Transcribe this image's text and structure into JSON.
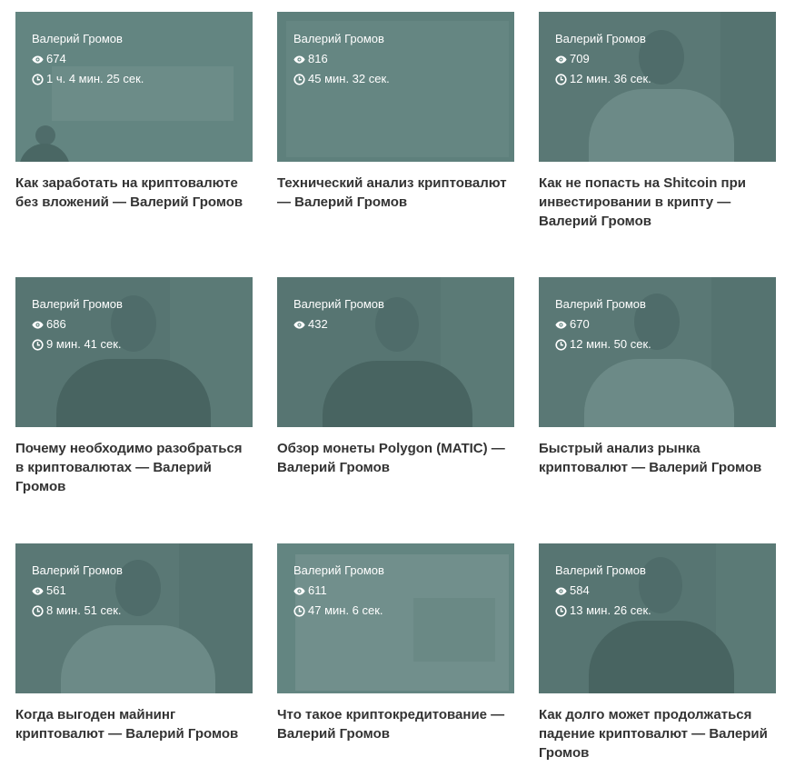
{
  "cards": [
    {
      "author": "Валерий Громов",
      "views": "674",
      "duration": "1 ч. 4 мин. 25 сек.",
      "title": "Как заработать на криптовалюте без вложений — Валерий Громов"
    },
    {
      "author": "Валерий Громов",
      "views": "816",
      "duration": "45 мин. 32 сек.",
      "title": "Технический анализ криптовалют — Валерий Громов"
    },
    {
      "author": "Валерий Громов",
      "views": "709",
      "duration": "12 мин. 36 сек.",
      "title": "Как не попасть на Shitcoin при инвестировании в крипту — Валерий Громов"
    },
    {
      "author": "Валерий Громов",
      "views": "686",
      "duration": "9 мин. 41 сек.",
      "title": "Почему необходимо разобраться в криптовалютах — Валерий Громов"
    },
    {
      "author": "Валерий Громов",
      "views": "432",
      "duration": "",
      "title": "Обзор монеты Polygon (MATIC) — Валерий Громов"
    },
    {
      "author": "Валерий Громов",
      "views": "670",
      "duration": "12 мин. 50 сек.",
      "title": "Быстрый анализ рынка криптовалют — Валерий Громов"
    },
    {
      "author": "Валерий Громов",
      "views": "561",
      "duration": "8 мин. 51 сек.",
      "title": "Когда выгоден майнинг криптовалют — Валерий Громов"
    },
    {
      "author": "Валерий Громов",
      "views": "611",
      "duration": "47 мин. 6 сек.",
      "title": "Что такое криптокредитование — Валерий Громов"
    },
    {
      "author": "Валерий Громов",
      "views": "584",
      "duration": "13 мин. 26 сек.",
      "title": "Как долго может продолжаться падение криптовалют — Валерий Громов"
    }
  ],
  "icons": {
    "views": "eye-icon",
    "duration": "clock-icon"
  },
  "colors": {
    "thumbnail_tint": "#5c807c",
    "title_text": "#333333",
    "meta_text": "#ffffff"
  }
}
